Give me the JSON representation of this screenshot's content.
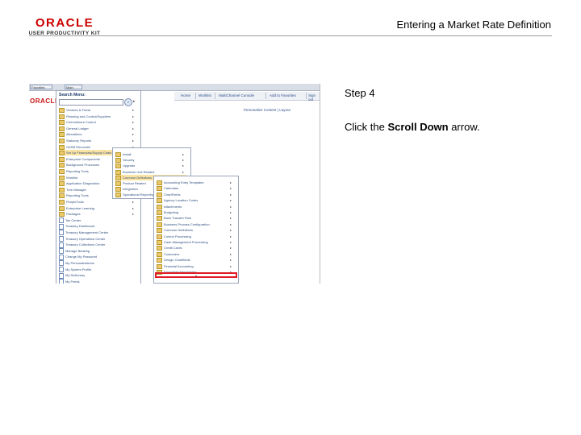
{
  "header": {
    "logo_text": "ORACLE",
    "logo_subtext": "USER PRODUCTIVITY KIT",
    "title": "Entering a Market Rate Definition"
  },
  "instruction": {
    "step": "Step 4",
    "prefix": "Click the ",
    "target": "Scroll Down",
    "suffix": " arrow."
  },
  "screenshot": {
    "favorites_label": "Favorites",
    "main_menu_label": "Main Menu",
    "mini_logo": "ORACLE",
    "top_links": [
      "Home",
      "Worklist",
      "MultiChannel Console",
      "Add to Favorites",
      "Sign out"
    ],
    "personalize": "Personalize Content | Layout",
    "menu_title": "Search Menu:",
    "go_label": "»",
    "menu1_items": [
      {
        "label": "Vendors & Fiscal",
        "icon": "folder"
      },
      {
        "label": "Planning and Control/Suppliers",
        "icon": "folder"
      },
      {
        "label": "Commitment Control",
        "icon": "folder"
      },
      {
        "label": "General Ledger",
        "icon": "folder"
      },
      {
        "label": "Allocations",
        "icon": "folder"
      },
      {
        "label": "Statutory Reports",
        "icon": "folder"
      },
      {
        "label": "GASB Reconcile",
        "icon": "folder"
      },
      {
        "label": "Set Up Financials/Supply Chain",
        "icon": "folder",
        "highlight": true
      },
      {
        "label": "Enterprise Components",
        "icon": "folder"
      },
      {
        "label": "Background Processes",
        "icon": "folder"
      },
      {
        "label": "Reporting Tools",
        "icon": "folder"
      },
      {
        "label": "Worklist",
        "icon": "folder"
      },
      {
        "label": "Application Diagnostics",
        "icon": "folder"
      },
      {
        "label": "Tree Manager",
        "icon": "folder"
      },
      {
        "label": "Reporting Tools",
        "icon": "folder"
      },
      {
        "label": "PeopleTools",
        "icon": "folder"
      },
      {
        "label": "Enterprise Learning",
        "icon": "folder"
      },
      {
        "label": "Packages",
        "icon": "folder"
      },
      {
        "label": "Tax Center",
        "icon": "page"
      },
      {
        "label": "Treasury Dashboard",
        "icon": "page"
      },
      {
        "label": "Treasury Management Center",
        "icon": "page"
      },
      {
        "label": "Treasury Operations Center",
        "icon": "page"
      },
      {
        "label": "Treasury Collections Center",
        "icon": "page"
      },
      {
        "label": "Manage Banking",
        "icon": "page"
      },
      {
        "label": "Change My Password",
        "icon": "page"
      },
      {
        "label": "My Personalizations",
        "icon": "page"
      },
      {
        "label": "My System Profile",
        "icon": "page"
      },
      {
        "label": "My Dictionary",
        "icon": "page"
      },
      {
        "label": "My Feeds",
        "icon": "page"
      }
    ],
    "menu2_items": [
      {
        "label": "Install"
      },
      {
        "label": "Security"
      },
      {
        "label": "Upgrade"
      },
      {
        "label": "Business Unit Related"
      },
      {
        "label": "Common Definitions",
        "highlight": true
      },
      {
        "label": "Product Related"
      },
      {
        "label": "Integration"
      },
      {
        "label": "Operational Reporting"
      }
    ],
    "menu3_items": [
      "Accounting Entry Templates",
      "Calendars",
      "ChartFields",
      "Agency Location Codes",
      "Attachments",
      "Budgeting",
      "Bank Transfer Rule",
      "Business Process Configuration",
      "Common Definitions",
      "Control Processing",
      "Cash Management Processing",
      "Credit Cards",
      "Customers",
      "Design Chartfields",
      "Financial Accounting",
      "Document Sequencing"
    ]
  }
}
